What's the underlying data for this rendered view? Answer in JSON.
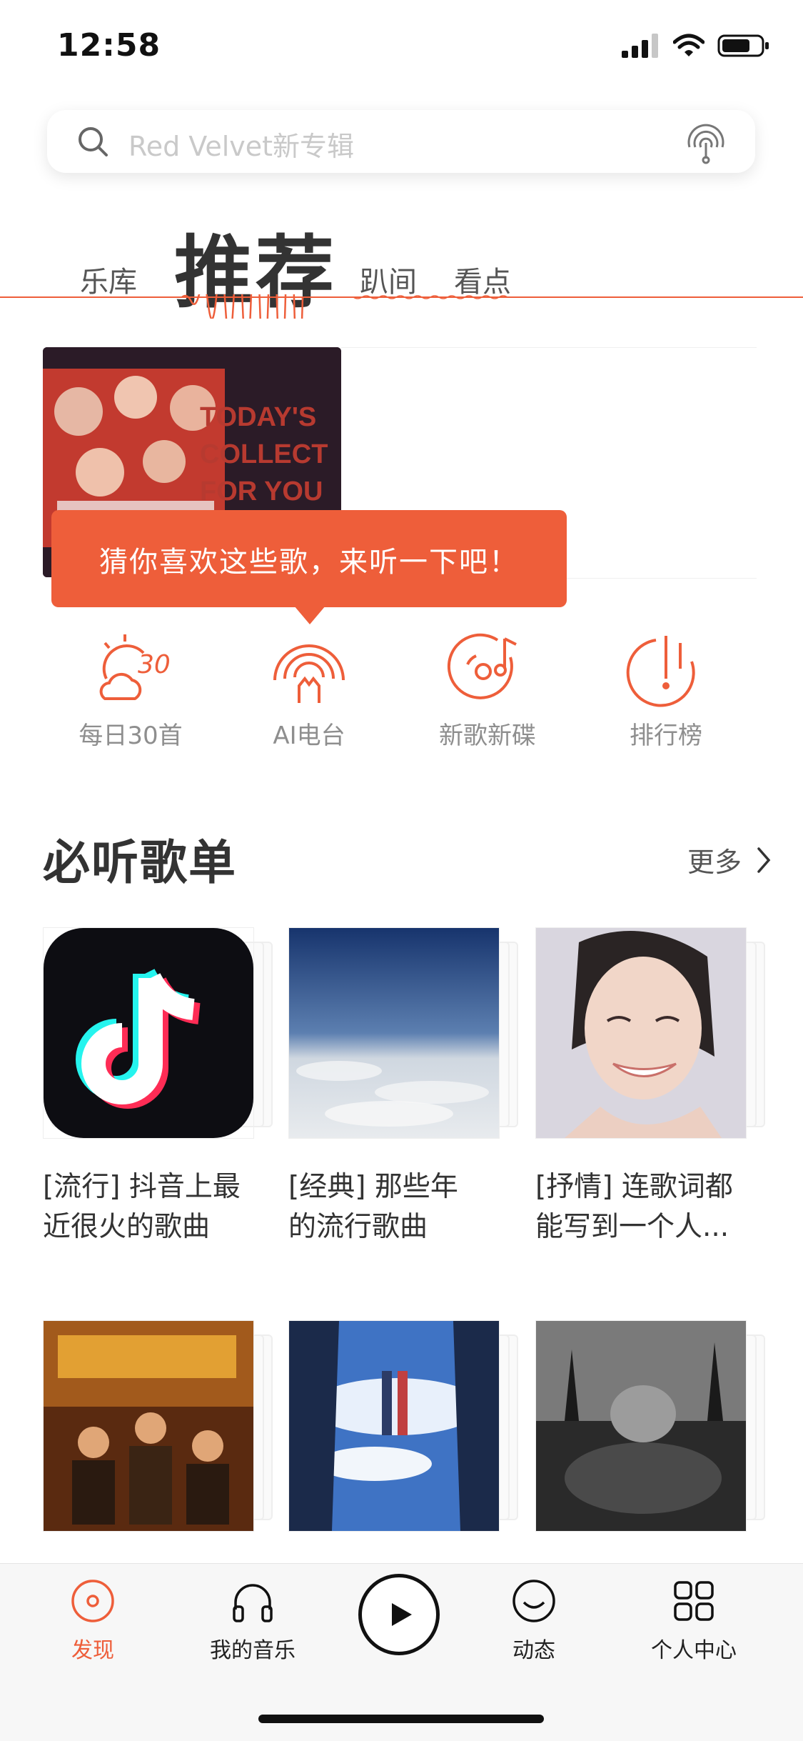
{
  "status_bar": {
    "time": "12:58"
  },
  "search": {
    "placeholder": "Red Velvet新专辑"
  },
  "tabs": [
    {
      "label": "乐库",
      "active": false
    },
    {
      "label": "推荐",
      "active": true
    },
    {
      "label": "趴间",
      "active": false
    },
    {
      "label": "看点",
      "active": false
    }
  ],
  "banner": {
    "lines": [
      "TODAY'S",
      "COLLECT",
      "FOR YOU"
    ]
  },
  "tooltip": {
    "text": "猜你喜欢这些歌，来听一下吧！"
  },
  "quick_entries": [
    {
      "label": "每日30首",
      "icon": "daily-30-icon",
      "badge": "30"
    },
    {
      "label": "AI电台",
      "icon": "ai-radio-icon"
    },
    {
      "label": "新歌新碟",
      "icon": "new-album-icon"
    },
    {
      "label": "排行榜",
      "icon": "chart-rank-icon"
    }
  ],
  "section": {
    "title": "必听歌单",
    "more": "更多"
  },
  "playlists": [
    {
      "line1": "[流行] 抖音上最",
      "line2": "近很火的歌曲"
    },
    {
      "line1": "[经典] 那些年",
      "line2": "的流行歌曲"
    },
    {
      "line1": "[抒情] 连歌词都",
      "line2": "能写到一个人..."
    }
  ],
  "tab_bar": [
    {
      "label": "发现",
      "active": true
    },
    {
      "label": "我的音乐",
      "active": false
    },
    {
      "label": "动态",
      "active": false
    },
    {
      "label": "个人中心",
      "active": false
    }
  ],
  "colors": {
    "accent": "#ee5e3a",
    "text": "#333333"
  }
}
